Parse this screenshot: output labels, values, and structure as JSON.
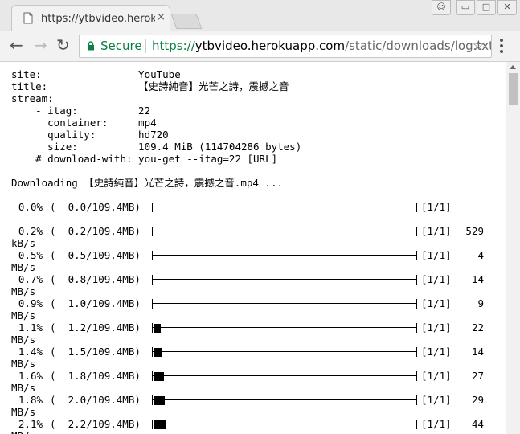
{
  "browser": {
    "tab": {
      "title": "https://ytbvideo.herokuapp.com/static/downloads/log.txt",
      "close": "×"
    },
    "window": {
      "minimize": "▭",
      "maximize": "□",
      "close": "✕",
      "profile": "☺"
    },
    "nav": {
      "back": "←",
      "forward": "→",
      "reload": "↻"
    },
    "omnibox": {
      "secure_label": "Secure",
      "url_scheme": "https://",
      "url_host": "ytbvideo.herokuapp.com",
      "url_path": "/static/downloads/log.txt",
      "star": "☆"
    }
  },
  "log": {
    "header_lines": [
      "site:                YouTube",
      "title:               【史詩純音】光芒之詩，震撼之音",
      "stream:",
      "    - itag:          22",
      "      container:     mp4",
      "      quality:       hd720",
      "      size:          109.4 MiB (114704286 bytes)",
      "    # download-with: you-get --itag=22 [URL]"
    ],
    "downloading_line": "Downloading 【史詩純音】光芒之詩，震撼之音.mp4 ...",
    "progress": [
      {
        "percent": "0.0%",
        "size": "(  0.0/109.4MB)",
        "count": "[1/1]",
        "speed": "",
        "unit": "",
        "fill_fraction": 0.0
      },
      {
        "percent": "0.2%",
        "size": "(  0.2/109.4MB)",
        "count": "[1/1]",
        "speed": "529",
        "unit": "kB/s",
        "fill_fraction": 0.0
      },
      {
        "percent": "0.5%",
        "size": "(  0.5/109.4MB)",
        "count": "[1/1]",
        "speed": "4",
        "unit": "MB/s",
        "fill_fraction": 0.0
      },
      {
        "percent": "0.7%",
        "size": "(  0.8/109.4MB)",
        "count": "[1/1]",
        "speed": "14",
        "unit": "MB/s",
        "fill_fraction": 0.0
      },
      {
        "percent": "0.9%",
        "size": "(  1.0/109.4MB)",
        "count": "[1/1]",
        "speed": "9",
        "unit": "MB/s",
        "fill_fraction": 0.0
      },
      {
        "percent": "1.1%",
        "size": "(  1.2/109.4MB)",
        "count": "[1/1]",
        "speed": "22",
        "unit": "MB/s",
        "fill_fraction": 0.011
      },
      {
        "percent": "1.4%",
        "size": "(  1.5/109.4MB)",
        "count": "[1/1]",
        "speed": "14",
        "unit": "MB/s",
        "fill_fraction": 0.014
      },
      {
        "percent": "1.6%",
        "size": "(  1.8/109.4MB)",
        "count": "[1/1]",
        "speed": "27",
        "unit": "MB/s",
        "fill_fraction": 0.016
      },
      {
        "percent": "1.8%",
        "size": "(  2.0/109.4MB)",
        "count": "[1/1]",
        "speed": "29",
        "unit": "MB/s",
        "fill_fraction": 0.018
      },
      {
        "percent": "2.1%",
        "size": "(  2.2/109.4MB)",
        "count": "[1/1]",
        "speed": "44",
        "unit": "MB/s",
        "fill_fraction": 0.021
      }
    ]
  },
  "colors": {
    "secure": "#0b8043",
    "url_path": "#666666",
    "text": "#000000"
  }
}
